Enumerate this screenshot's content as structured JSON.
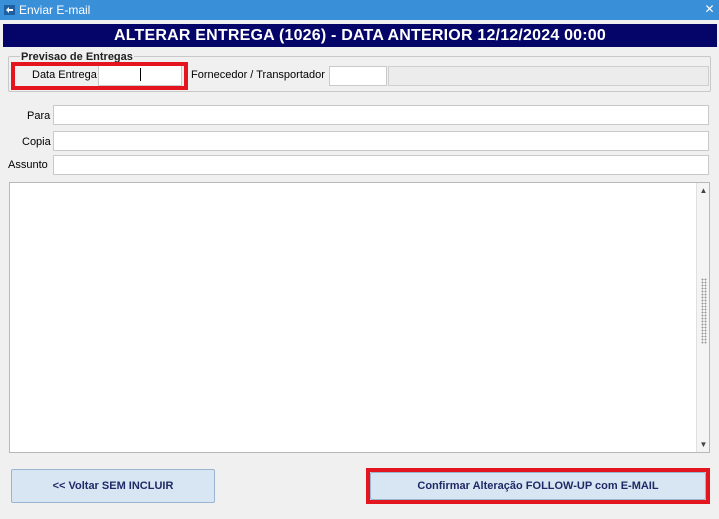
{
  "window": {
    "title": "Enviar E-mail",
    "close_glyph": "✕"
  },
  "header": {
    "banner": "ALTERAR ENTREGA (1026) - DATA ANTERIOR 12/12/2024 00:00"
  },
  "previsao": {
    "legend": "Previsao de Entregas",
    "data_entrega_label": "Data Entrega",
    "data_entrega_value": "",
    "fornecedor_label": "Fornecedor / Transportador",
    "fornecedor_value": "",
    "fornecedor_name_value": ""
  },
  "email": {
    "para_label": "Para",
    "para_value": "",
    "copia_label": "Copia",
    "copia_value": "",
    "assunto_label": "Assunto",
    "assunto_value": "",
    "body_value": ""
  },
  "buttons": {
    "back_label": "<< Voltar SEM INCLUIR",
    "confirm_label": "Confirmar Alteração FOLLOW-UP com E-MAIL"
  },
  "icons": {
    "app": "email-app-icon",
    "close": "close-icon",
    "scroll_up": "scroll-up-arrow-icon",
    "scroll_down": "scroll-down-arrow-icon"
  },
  "colors": {
    "titlebar": "#3a8fd9",
    "banner_bg": "#050569",
    "highlight": "#e3161f",
    "button_bg": "#d8e6f3",
    "button_text": "#1f2a66"
  }
}
